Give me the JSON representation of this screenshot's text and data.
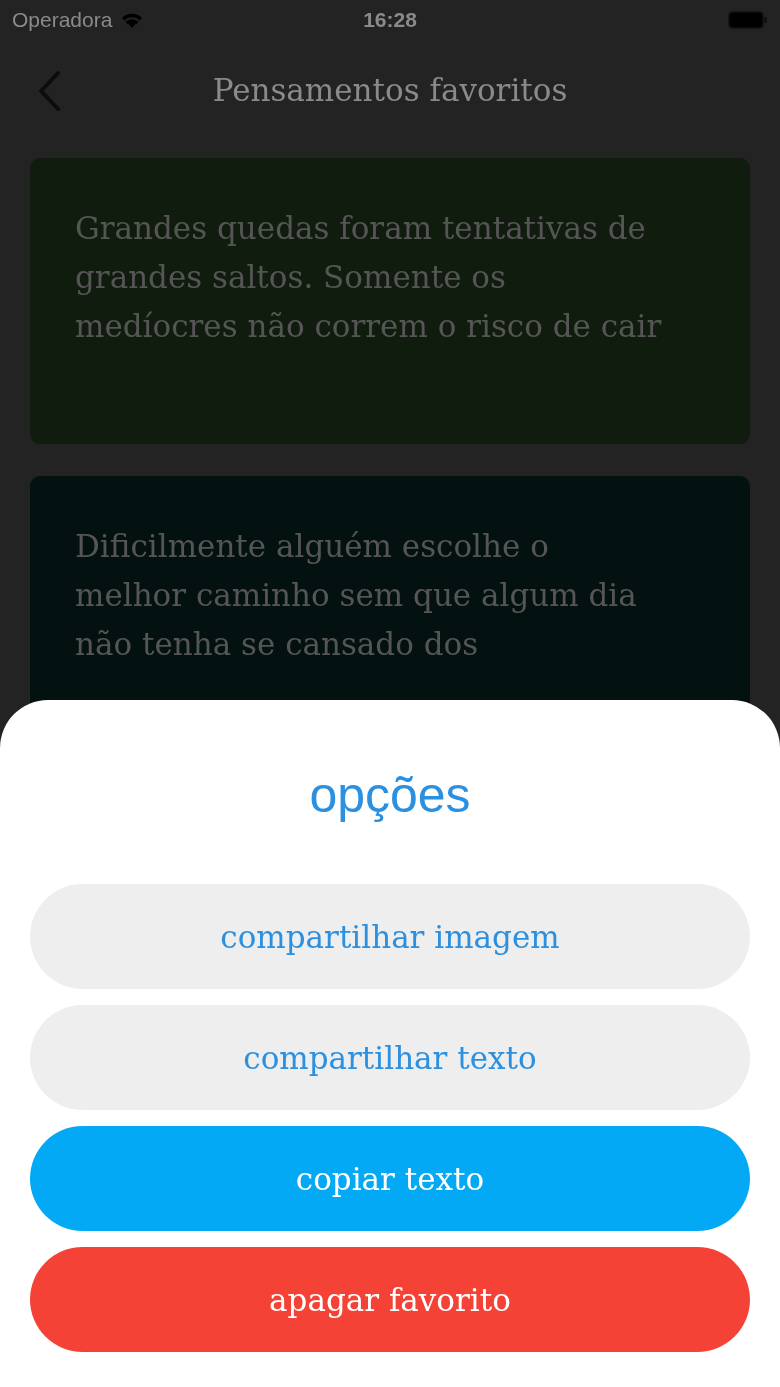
{
  "status_bar": {
    "carrier": "Operadora",
    "time": "16:28"
  },
  "nav": {
    "title": "Pensamentos favoritos"
  },
  "cards": [
    {
      "text": "Grandes quedas foram tentativas de grandes saltos. Somente os medíocres não correm o risco de cair",
      "color": "#101c0d"
    },
    {
      "text": "Dificilmente alguém escolhe o melhor caminho sem que algum dia não tenha se cansado dos",
      "color": "#031110"
    }
  ],
  "sheet": {
    "title": "opções",
    "buttons": [
      {
        "label": "compartilhar imagem",
        "kind": "neutral"
      },
      {
        "label": "compartilhar texto",
        "kind": "neutral"
      },
      {
        "label": "copiar texto",
        "kind": "primary"
      },
      {
        "label": "apagar favorito",
        "kind": "danger"
      }
    ]
  }
}
